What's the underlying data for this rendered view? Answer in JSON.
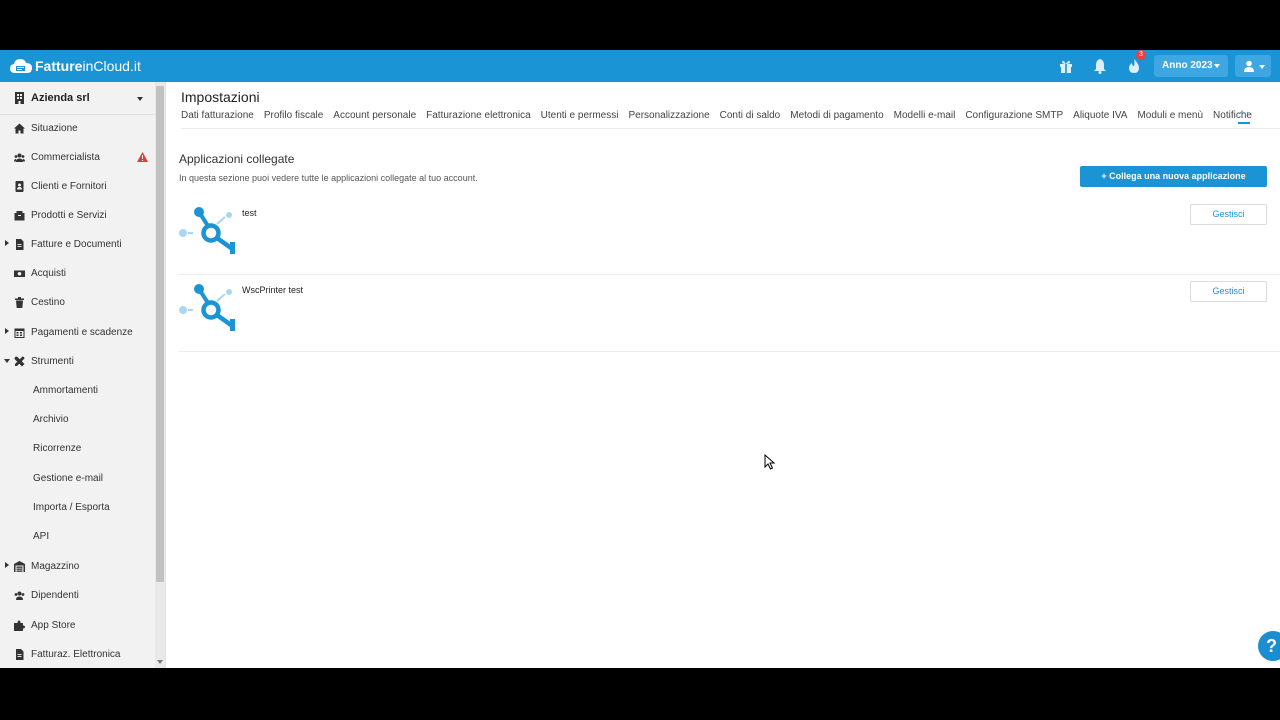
{
  "topbar": {
    "brand_bold": "Fatture",
    "brand_mid": "inCloud",
    "brand_end": ".it",
    "icons": [
      "gift-icon",
      "bell-icon",
      "flame-icon"
    ],
    "notification_count": "3",
    "year_label": "Anno 2023",
    "accent_color": "#1b94d6"
  },
  "sidebar": {
    "company": "Azienda srl",
    "items": [
      {
        "label": "Situazione",
        "icon": "home-icon"
      },
      {
        "label": "Commercialista",
        "icon": "users-icon",
        "warning": true
      },
      {
        "label": "Clienti e Fornitori",
        "icon": "address-book-icon"
      },
      {
        "label": "Prodotti e Servizi",
        "icon": "box-icon"
      },
      {
        "label": "Fatture e Documenti",
        "icon": "document-icon",
        "expandable": true
      },
      {
        "label": "Acquisti",
        "icon": "money-icon"
      },
      {
        "label": "Cestino",
        "icon": "trash-icon"
      },
      {
        "label": "Pagamenti e scadenze",
        "icon": "calendar-icon",
        "expandable": true
      },
      {
        "label": "Strumenti",
        "icon": "tools-icon",
        "expanded": true
      }
    ],
    "sub_items": [
      "Ammortamenti",
      "Archivio",
      "Ricorrenze",
      "Gestione e-mail",
      "Importa / Esporta",
      "API"
    ],
    "bottom_items": [
      {
        "label": "Magazzino",
        "icon": "warehouse-icon",
        "expandable": true
      },
      {
        "label": "Dipendenti",
        "icon": "users-icon"
      },
      {
        "label": "App Store",
        "icon": "puzzle-icon"
      },
      {
        "label": "Fatturaz. Elettronica",
        "icon": "document-icon"
      }
    ]
  },
  "main": {
    "title": "Impostazioni",
    "tabs": [
      "Dati fatturazione",
      "Profilo fiscale",
      "Account personale",
      "Fatturazione elettronica",
      "Utenti e permessi",
      "Personalizzazione",
      "Conti di saldo",
      "Metodi di pagamento",
      "Modelli e-mail",
      "Configurazione SMTP",
      "Aliquote IVA",
      "Moduli e menù",
      "Notifiche"
    ],
    "tab_more": "···",
    "section_title": "Applicazioni collegate",
    "section_desc": "In questa sezione puoi vedere tutte le applicazioni collegate al tuo account.",
    "add_button": "+ Collega una nuova applicazione",
    "apps": [
      {
        "name": "test",
        "action": "Gestisci"
      },
      {
        "name": "WscPrinter test",
        "action": "Gestisci"
      }
    ],
    "help_label": "?"
  }
}
